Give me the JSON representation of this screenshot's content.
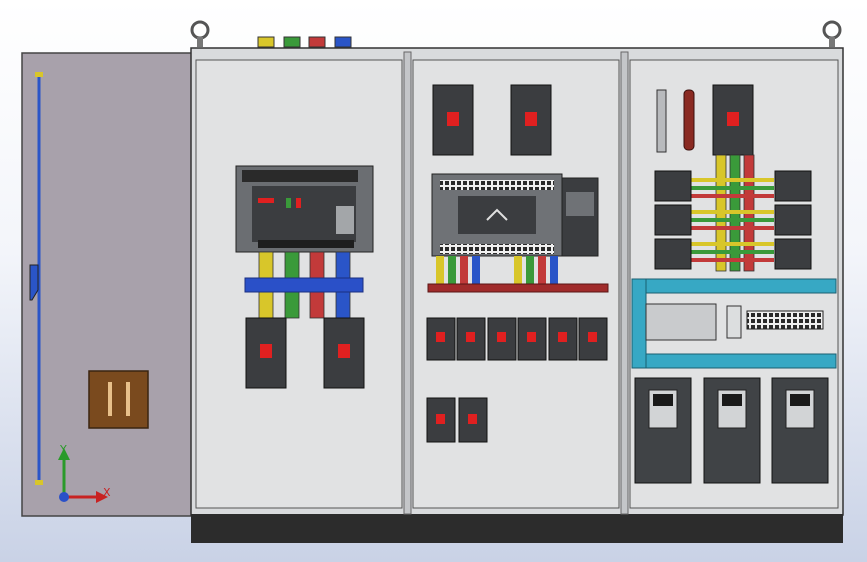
{
  "triad": {
    "x_label": "X",
    "y_label": "Y"
  },
  "colors": {
    "door": "#a8a1ab",
    "enclosure": "#d9dbdd",
    "panel": "#e1e2e3",
    "plinth": "#2c2c2c",
    "breaker_body": "#3b3d40",
    "breaker_toggle": "#e02020",
    "bus_yellow": "#d8c62a",
    "bus_green": "#3a9a3a",
    "bus_red": "#c23a3a",
    "bus_blue": "#2a55c8",
    "busbar_blue": "#2a50c8",
    "busbar_red": "#a02b2b",
    "cable_tray": "#37a8c4",
    "handle_brown": "#7a4a1e",
    "vfd_body": "#404346",
    "copper_bar": "#8a2a22"
  }
}
